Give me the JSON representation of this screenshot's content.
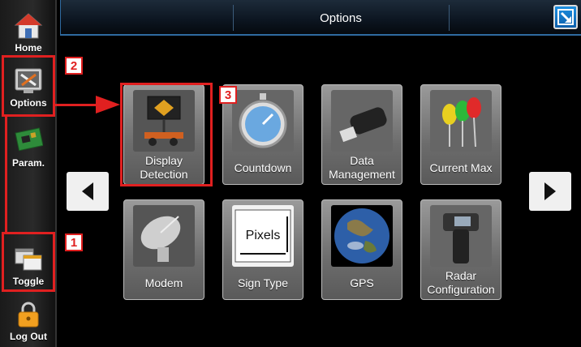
{
  "window": {
    "title": "Options"
  },
  "sidebar": {
    "items": [
      {
        "label": "Home",
        "icon": "home-icon"
      },
      {
        "label": "Options",
        "icon": "tools-icon"
      },
      {
        "label": "Param.",
        "icon": "circuit-board-icon"
      },
      {
        "label": "Toggle",
        "icon": "toggle-windows-icon"
      },
      {
        "label": "Log Out",
        "icon": "padlock-icon"
      }
    ]
  },
  "grid": {
    "tiles": [
      {
        "label": "Display Detection",
        "icon": "sign-trailer-icon"
      },
      {
        "label": "Countdown",
        "icon": "stopwatch-icon"
      },
      {
        "label": "Data Management",
        "icon": "usb-drive-icon"
      },
      {
        "label": "Current Max",
        "icon": "leds-icon"
      },
      {
        "label": "Modem",
        "icon": "satellite-dish-icon"
      },
      {
        "label": "Sign Type",
        "icon": "pixels-sign-icon",
        "pic_text": "Pixels"
      },
      {
        "label": "GPS",
        "icon": "earth-globe-icon"
      },
      {
        "label": "Radar Configuration",
        "icon": "radar-gun-icon"
      }
    ]
  },
  "navigation": {
    "prev": "chevron-left-icon",
    "next": "chevron-right-icon"
  },
  "annotations": [
    {
      "number": "1",
      "target": "Toggle"
    },
    {
      "number": "2",
      "target": "Options"
    },
    {
      "number": "3",
      "target": "Display Detection"
    }
  ],
  "colors": {
    "annotation": "#e02020",
    "accent": "#2f6aa0"
  }
}
